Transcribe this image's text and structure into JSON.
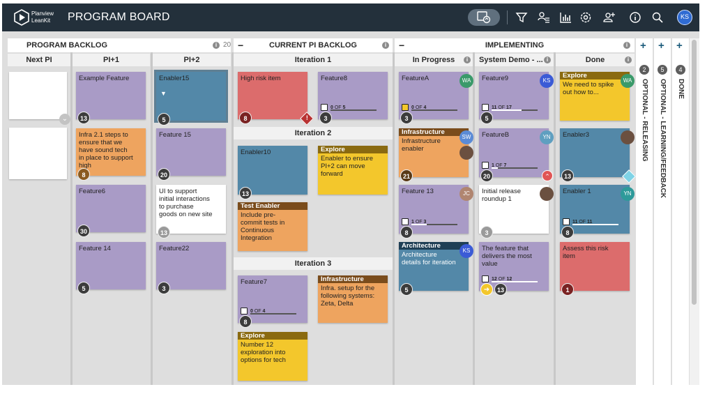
{
  "header": {
    "logo_line1": "Planview",
    "logo_line2": "LeanKit",
    "title": "PROGRAM BOARD",
    "user_initials": "KS"
  },
  "icons": [
    "view-icon",
    "filter-icon",
    "assignee-filter-icon",
    "reports-icon",
    "settings-icon",
    "add-user-icon",
    "info-icon",
    "search-icon"
  ],
  "lanes": {
    "program_backlog": {
      "title": "PROGRAM BACKLOG",
      "count": "20",
      "subs": [
        "Next PI",
        "PI+1",
        "PI+2"
      ]
    },
    "current_pi": {
      "title": "CURRENT PI BACKLOG",
      "iterations": [
        "Iteration 1",
        "Iteration 2",
        "Iteration 3"
      ]
    },
    "implementing": {
      "title": "IMPLEMENTING",
      "subs": [
        "In Progress",
        "System Demo - ...",
        "Done"
      ]
    },
    "collapsed": [
      {
        "num": "2",
        "title": "OPTIONAL - RELEASING"
      },
      {
        "num": "5",
        "title": "OPTIONAL - LEARNING/FEEDBACK"
      },
      {
        "num": "4",
        "title": "DONE"
      }
    ]
  },
  "cards": [
    {
      "tag": "",
      "title": "Example Feature",
      "size": "13"
    },
    {
      "tag": "",
      "title": "Infra 2.1 steps to ensure that we have sound tech in place to support high",
      "size": "8"
    },
    {
      "tag": "",
      "title": "Feature6",
      "size": "30"
    },
    {
      "tag": "",
      "title": "Feature 14",
      "size": "5"
    },
    {
      "tag": "",
      "title": "Enabler15",
      "size": "5"
    },
    {
      "tag": "",
      "title": "Feature 15",
      "size": "20"
    },
    {
      "tag": "",
      "title": "UI to support initial interactions to purchase goods on new site",
      "size": "13"
    },
    {
      "tag": "",
      "title": "Feature22",
      "size": "3"
    },
    {
      "tag": "",
      "title": "High risk item",
      "size": "8"
    },
    {
      "tag": "",
      "title": "Feature8",
      "size": "3",
      "progress": {
        "done": "0",
        "of": "OF",
        "total": "5",
        "fraction": 0
      }
    },
    {
      "tag": "",
      "title": "Enabler10",
      "size": "13"
    },
    {
      "tag": "Explore",
      "title": "Enabler to ensure PI+2 can move forward",
      "size": ""
    },
    {
      "tag": "Test Enabler",
      "title": "Include pre-commit tests in Continuous Integration",
      "size": ""
    },
    {
      "tag": "",
      "title": "Feature7",
      "size": "8",
      "progress": {
        "done": "0",
        "of": "OF",
        "total": "4",
        "fraction": 0
      }
    },
    {
      "tag": "Infrastructure",
      "title": "Infra. setup for the following systems: Zeta, Delta",
      "size": ""
    },
    {
      "tag": "Explore",
      "title": "Number 12 exploration into options for tech",
      "size": ""
    },
    {
      "tag": "",
      "title": "FeatureA",
      "size": "3",
      "avatar": "WA",
      "progress": {
        "done": "0",
        "of": "OF",
        "total": "4",
        "fraction": 0
      }
    },
    {
      "tag": "Infrastructure",
      "title": "Infrastructure enabler",
      "size": "21",
      "avatar": "SW"
    },
    {
      "tag": "",
      "title": "Feature 13",
      "size": "8",
      "avatar": "JC",
      "progress": {
        "done": "1",
        "of": "OF",
        "total": "3",
        "fraction": 0.33
      }
    },
    {
      "tag": "Architecture",
      "title": "Architecture details for iteration",
      "size": "5",
      "avatar": "KS"
    },
    {
      "tag": "",
      "title": "Feature9",
      "size": "5",
      "avatar": "KS",
      "progress": {
        "done": "11",
        "of": "OF",
        "total": "17",
        "fraction": 0.65
      }
    },
    {
      "tag": "",
      "title": "FeatureB",
      "size": "20",
      "avatar": "YN",
      "progress": {
        "done": "1",
        "of": "OF",
        "total": "7",
        "fraction": 0.14
      }
    },
    {
      "tag": "",
      "title": "Initial release roundup 1",
      "size": "3"
    },
    {
      "tag": "",
      "title": "The feature that delivers the most value",
      "size": "13",
      "progress": {
        "done": "12",
        "of": "OF",
        "total": "12",
        "fraction": 1
      }
    },
    {
      "tag": "Explore",
      "title": "We need to spike out how to...",
      "size": "",
      "avatar": "WA"
    },
    {
      "tag": "",
      "title": "Enabler3",
      "size": "13"
    },
    {
      "tag": "",
      "title": "Enabler 1",
      "size": "8",
      "avatar": "YN",
      "progress": {
        "done": "11",
        "of": "OF",
        "total": "11",
        "fraction": 1
      }
    },
    {
      "tag": "",
      "title": "Assess this risk item",
      "size": "1"
    }
  ]
}
